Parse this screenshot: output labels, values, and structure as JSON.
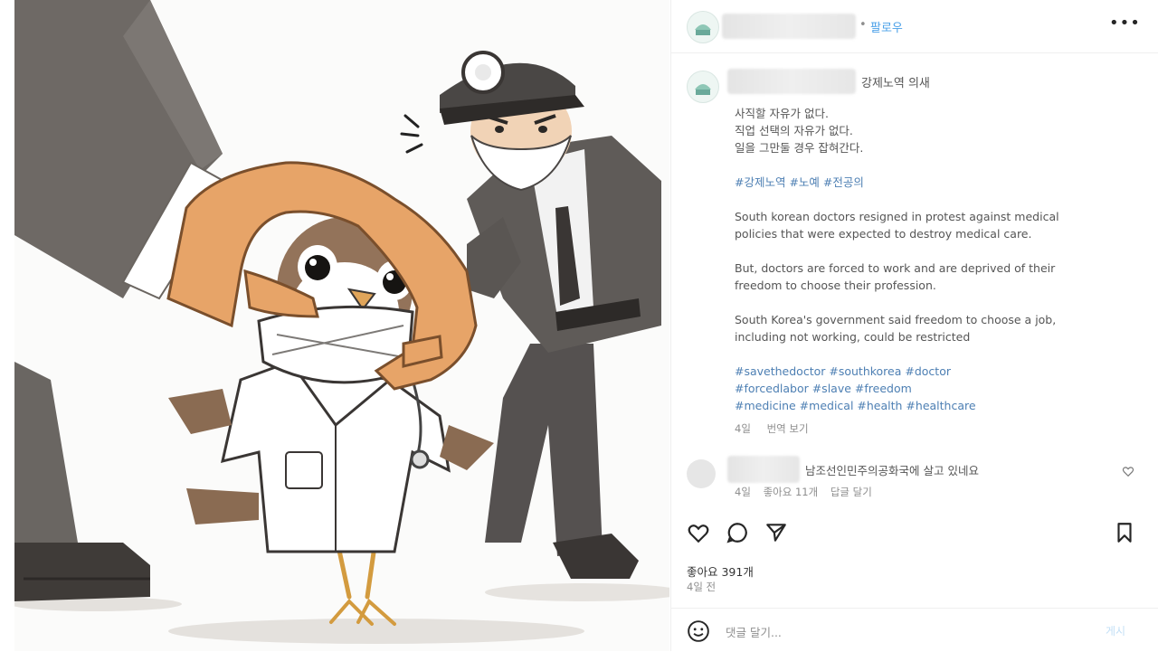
{
  "header": {
    "separator": "•",
    "follow_label": "팔로우",
    "more_label": "•••"
  },
  "caption": {
    "tag_line": "강제노역 의새",
    "lines_ko": [
      "사직할 자유가 없다.",
      "직업 선택의 자유가 없다.",
      "일을 그만둘 경우 잡혀간다."
    ],
    "hashtags_ko": "#강제노역 #노예 #전공의",
    "en_para1": [
      "South korean doctors resigned in protest against medical",
      "policies that were expected to destroy medical care."
    ],
    "en_para2": [
      "But, doctors are forced to work and are deprived of their",
      "freedom to choose their profession."
    ],
    "en_para3": [
      "South Korea's government said freedom to choose a job,",
      "including not working, could be restricted"
    ],
    "hashtags_en": [
      "#savethedoctor #southkorea #doctor",
      "#forcedlabor #slave #freedom",
      "#medicine #medical #health #healthcare"
    ],
    "age": "4일",
    "translate": "번역 보기"
  },
  "comment": {
    "text": "남조선인민주의공화국에 살고 있네요",
    "age": "4일",
    "likes": "좋아요 11개",
    "reply": "답글 달기"
  },
  "actions": {
    "like_icon": "heart-icon",
    "comment_icon": "comment-icon",
    "share_icon": "paper-plane-icon",
    "save_icon": "bookmark-icon"
  },
  "post": {
    "likes": "좋아요 391개",
    "time": "4일 전"
  },
  "comment_bar": {
    "emoji_icon": "smiley-icon",
    "placeholder": "댓글 달기...",
    "post_label": "게시"
  }
}
